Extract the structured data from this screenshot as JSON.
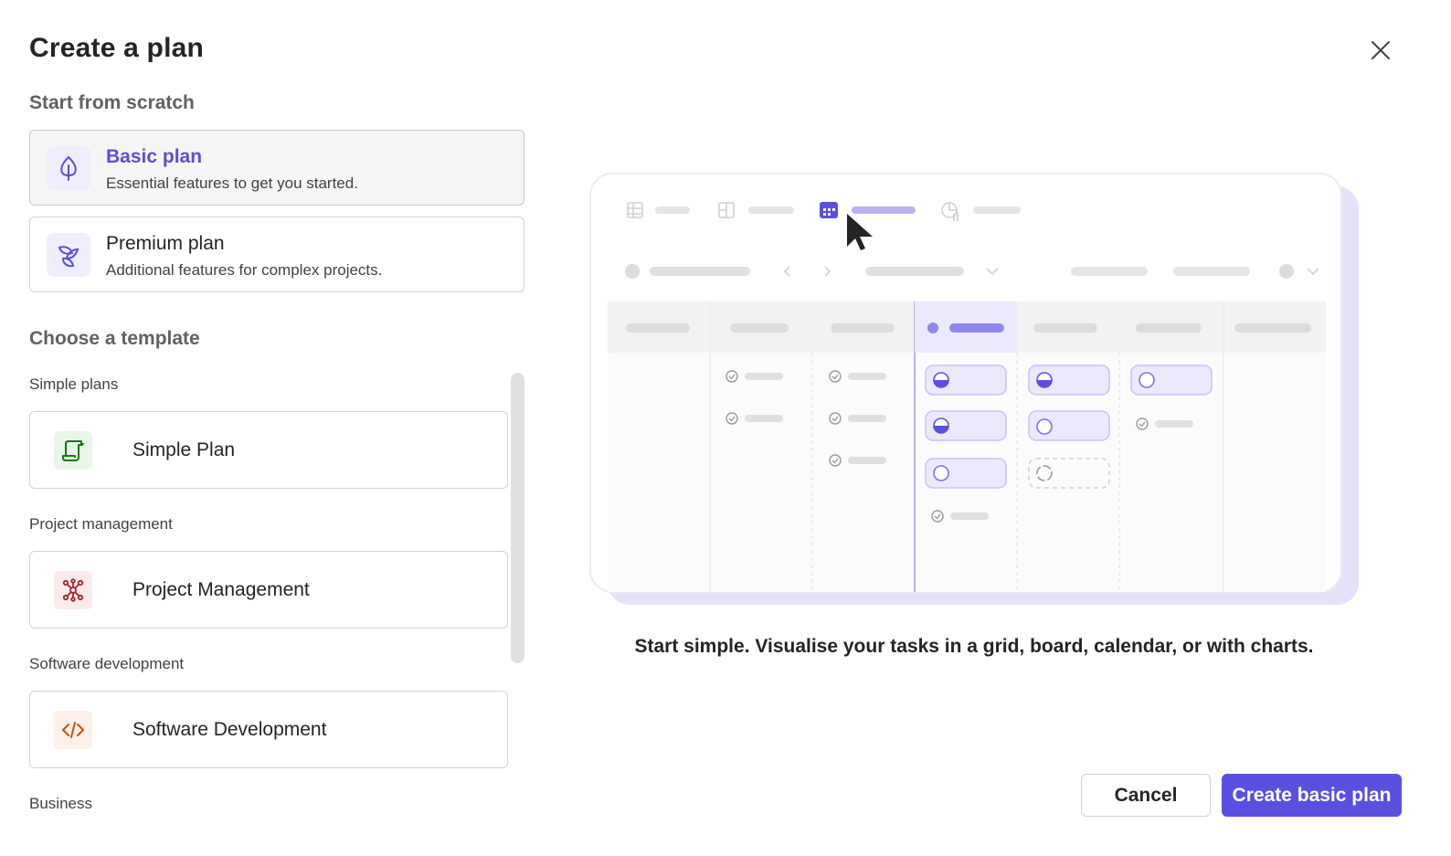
{
  "dialog": {
    "title": "Create a plan",
    "close_icon": "close-icon"
  },
  "scratch": {
    "heading": "Start from scratch",
    "plans": [
      {
        "name": "Basic plan",
        "description": "Essential features to get you started.",
        "icon": "leaf-icon",
        "selected": true
      },
      {
        "name": "Premium plan",
        "description": "Additional features for complex projects.",
        "icon": "premium-leaves-icon",
        "selected": false
      }
    ]
  },
  "templates": {
    "heading": "Choose a template",
    "groups": [
      {
        "label": "Simple plans",
        "template": "Simple Plan",
        "icon": "scroll-icon",
        "icon_color": "#107c10"
      },
      {
        "label": "Project management",
        "template": "Project Management",
        "icon": "network-icon",
        "icon_color": "#a4262c"
      },
      {
        "label": "Software development",
        "template": "Software Development",
        "icon": "code-icon",
        "icon_color": "#ca5010"
      },
      {
        "label": "Business",
        "template": "",
        "icon": "",
        "icon_color": ""
      }
    ]
  },
  "preview": {
    "caption": "Start simple. Visualise your tasks in a grid, board, calendar, or with charts."
  },
  "footer": {
    "cancel_label": "Cancel",
    "create_label": "Create basic plan"
  },
  "colors": {
    "accent": "#5b4fe0",
    "accent_light": "#e4e1fb"
  }
}
